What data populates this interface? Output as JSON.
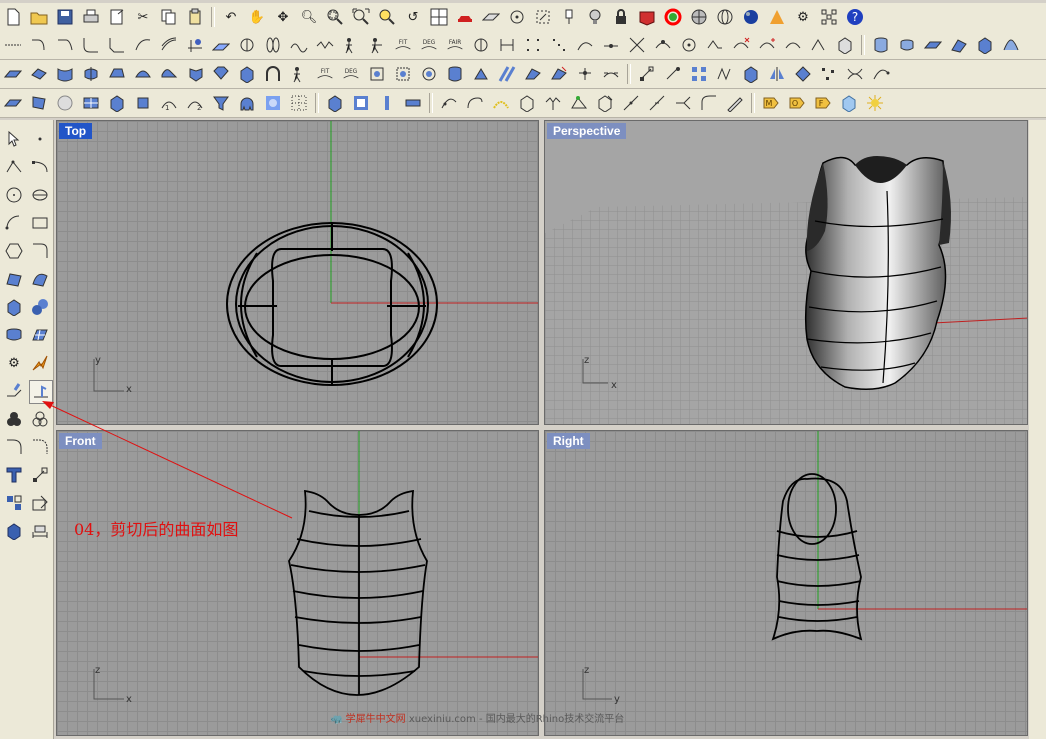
{
  "viewports": {
    "top": {
      "label": "Top"
    },
    "perspective": {
      "label": "Perspective"
    },
    "front": {
      "label": "Front"
    },
    "right": {
      "label": "Right"
    }
  },
  "axes": {
    "top": {
      "h": "x",
      "v": "y"
    },
    "perspective": {
      "h": "x",
      "v": "z"
    },
    "front": {
      "h": "x",
      "v": "z"
    },
    "right": {
      "h": "y",
      "v": "z"
    }
  },
  "toolbar_text": {
    "fit": "FIT",
    "deg": "DEG",
    "fair": "FAIR"
  },
  "annotation": {
    "text": "04，剪切后的曲面如图",
    "color": "#e01010"
  },
  "watermark": {
    "brand": "学犀牛中文网",
    "url": "xuexiniu.com",
    "slogan": "- 国内最大的Rhino技术交流平台"
  },
  "colors": {
    "active_title": "#2255c8",
    "inactive_title": "#7d8fc0",
    "x_axis": "#c02020",
    "y_axis": "#20a020"
  }
}
